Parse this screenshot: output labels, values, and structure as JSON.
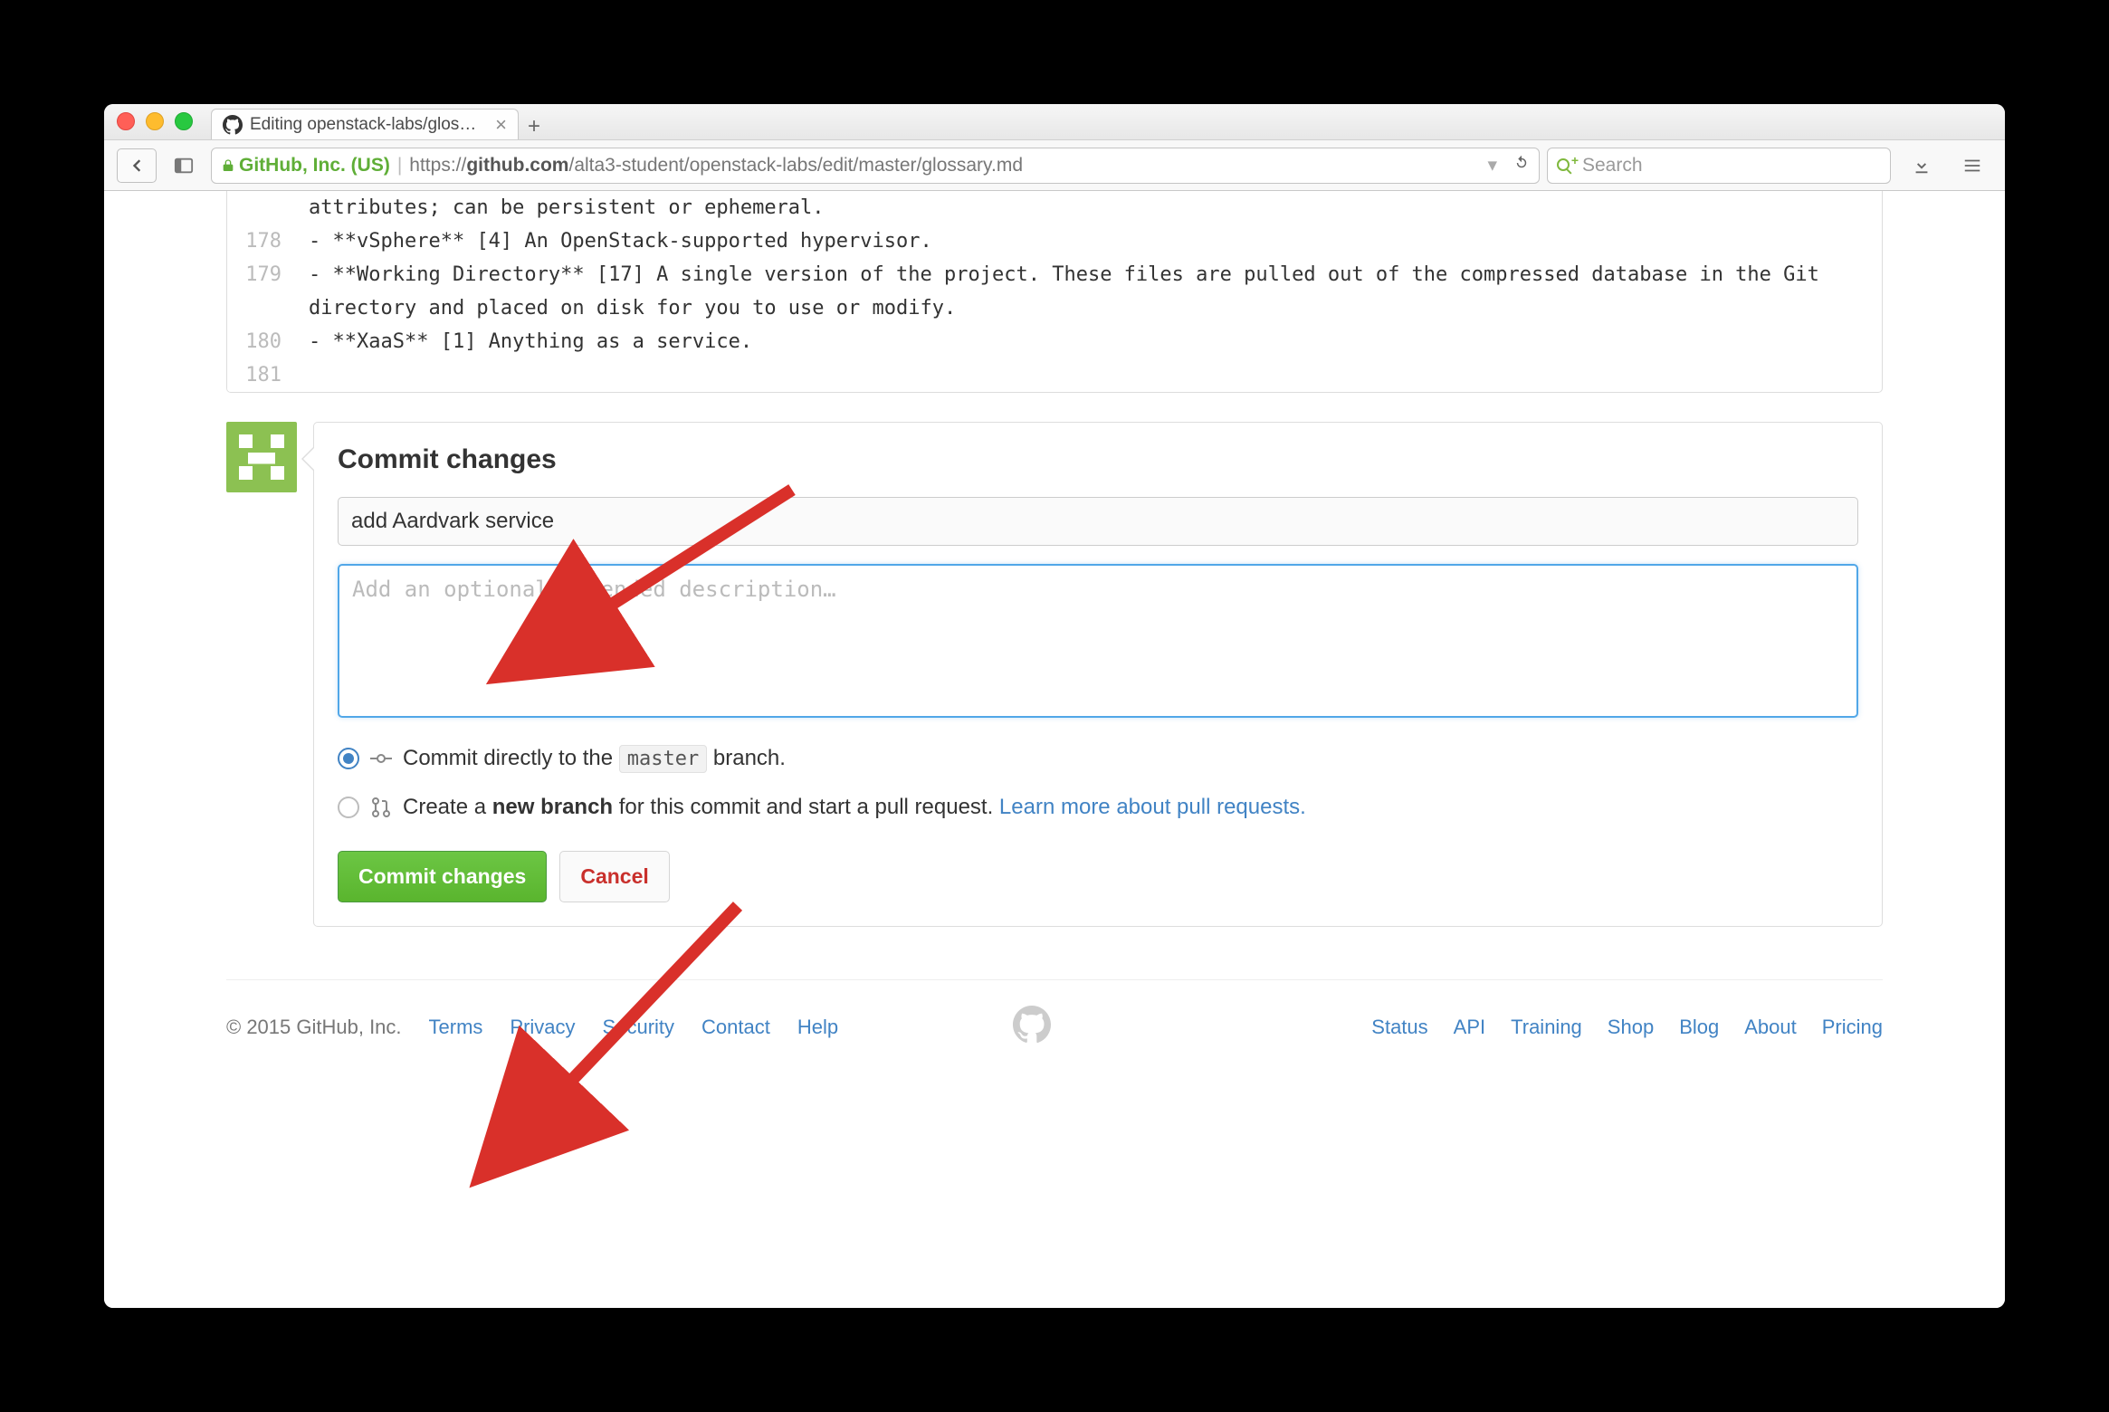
{
  "window": {
    "tab_title": "Editing openstack-labs/glos…"
  },
  "toolbar": {
    "identity": "GitHub, Inc. (US)",
    "url_prefix": "https://",
    "url_host": "github.com",
    "url_path": "/alta3-student/openstack-labs/edit/master/glossary.md",
    "search_placeholder": "Search"
  },
  "editor": {
    "lines": [
      {
        "n": "",
        "text": "attributes; can be persistent or ephemeral."
      },
      {
        "n": "178",
        "text": "**vSphere** [4] An OpenStack-supported hypervisor."
      },
      {
        "n": "179",
        "text": "**Working Directory** [17] A single version of the project. These files are pulled out of the compressed database in the Git"
      },
      {
        "n": "",
        "text": "directory and placed on disk for you to use or modify."
      },
      {
        "n": "180",
        "text": "**XaaS** [1] Anything as a service."
      },
      {
        "n": "181",
        "text": ""
      }
    ]
  },
  "commit": {
    "heading": "Commit changes",
    "summary_value": "add Aardvark service",
    "description_placeholder": "Add an optional extended description…",
    "radio_direct_pre": "Commit directly to the ",
    "radio_direct_branch": "master",
    "radio_direct_post": " branch.",
    "radio_new_pre": "Create a ",
    "radio_new_bold": "new branch",
    "radio_new_mid": " for this commit and start a pull request. ",
    "radio_new_link": "Learn more about pull requests.",
    "btn_commit": "Commit changes",
    "btn_cancel": "Cancel"
  },
  "footer": {
    "copyright": "© 2015 GitHub, Inc.",
    "left": [
      "Terms",
      "Privacy",
      "Security",
      "Contact",
      "Help"
    ],
    "right": [
      "Status",
      "API",
      "Training",
      "Shop",
      "Blog",
      "About",
      "Pricing"
    ]
  }
}
